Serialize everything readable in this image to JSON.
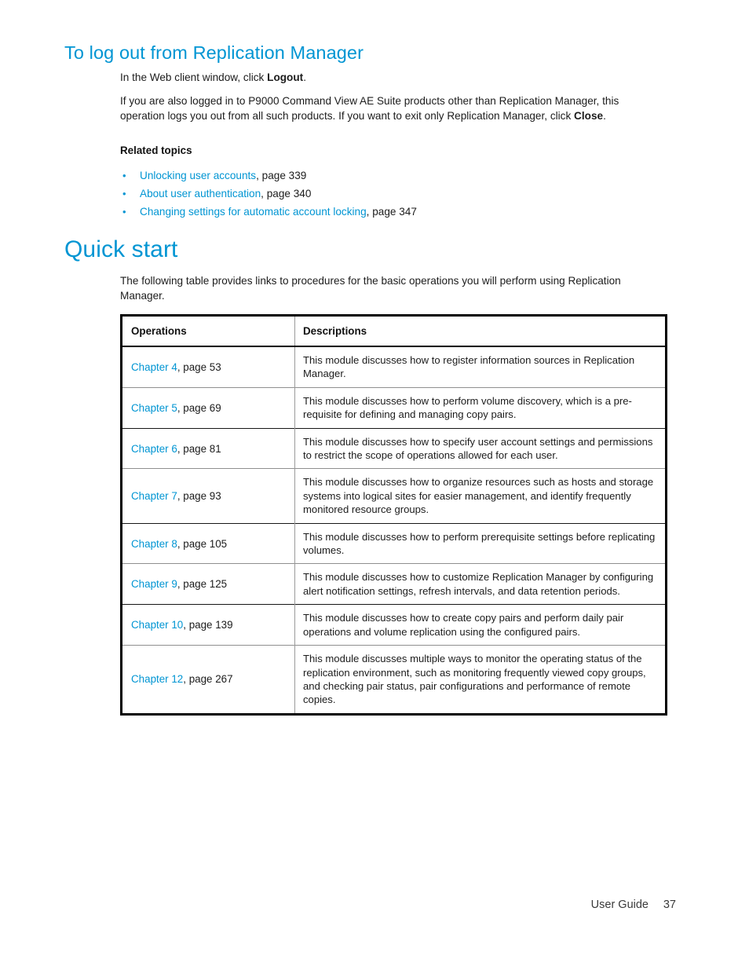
{
  "section": {
    "heading": "To log out from Replication Manager",
    "paragraph1_pre": "In the Web client window, click ",
    "paragraph1_bold": "Logout",
    "paragraph1_post": ".",
    "paragraph2_pre": "If you are also logged in to P9000 Command View AE Suite products other than Replication Manager, this operation logs you out from all such products. If you want to exit only Replication Manager, click ",
    "paragraph2_bold": "Close",
    "paragraph2_post": ".",
    "related_topics_label": "Related topics",
    "related_topics": [
      {
        "link": "Unlocking user accounts",
        "suffix": ", page 339"
      },
      {
        "link": "About user authentication",
        "suffix": ", page 340"
      },
      {
        "link": "Changing settings for automatic account locking",
        "suffix": ", page 347"
      }
    ]
  },
  "quick_start": {
    "heading": "Quick start",
    "intro": "The following table provides links to procedures for the basic operations you will perform using Replication Manager.",
    "table": {
      "headers": [
        "Operations",
        "Descriptions"
      ],
      "rows": [
        {
          "link": "Chapter 4",
          "suffix": ", page 53",
          "description": "This module discusses how to register information sources in Replication Manager."
        },
        {
          "link": "Chapter 5",
          "suffix": ", page 69",
          "description": "This module discusses how to perform volume discovery, which is a pre-requisite for defining and managing copy pairs."
        },
        {
          "link": "Chapter 6",
          "suffix": ", page 81",
          "description": "This module discusses how to specify user account settings and permissions to restrict the scope of operations allowed for each user."
        },
        {
          "link": "Chapter 7",
          "suffix": ", page 93",
          "description": "This module discusses how to organize resources such as hosts and storage systems into logical sites for easier management, and  identify frequently monitored resource groups."
        },
        {
          "link": "Chapter 8",
          "suffix": ", page 105",
          "description": "This module discusses how to perform prerequisite settings before replicating volumes."
        },
        {
          "link": "Chapter 9",
          "suffix": ", page 125",
          "description": "This module discusses how to customize Replication Manager by configuring alert notification settings, refresh intervals, and data retention periods."
        },
        {
          "link": "Chapter 10",
          "suffix": ", page 139",
          "description": "This module discusses how to create copy pairs and perform daily pair operations and volume replication using the configured pairs."
        },
        {
          "link": "Chapter 12",
          "suffix": ", page 267",
          "description": "This module discusses multiple ways to monitor the operating status of the replication environment, such as monitoring frequently viewed copy groups, and checking pair status, pair configurations and performance of remote copies."
        }
      ]
    }
  },
  "footer": {
    "label": "User Guide",
    "page_number": "37"
  },
  "colors": {
    "accent_blue": "#0095D3",
    "body_text": "#1c1c1c",
    "table_border": "#000000",
    "table_rule_gray": "#8f8f8f"
  }
}
